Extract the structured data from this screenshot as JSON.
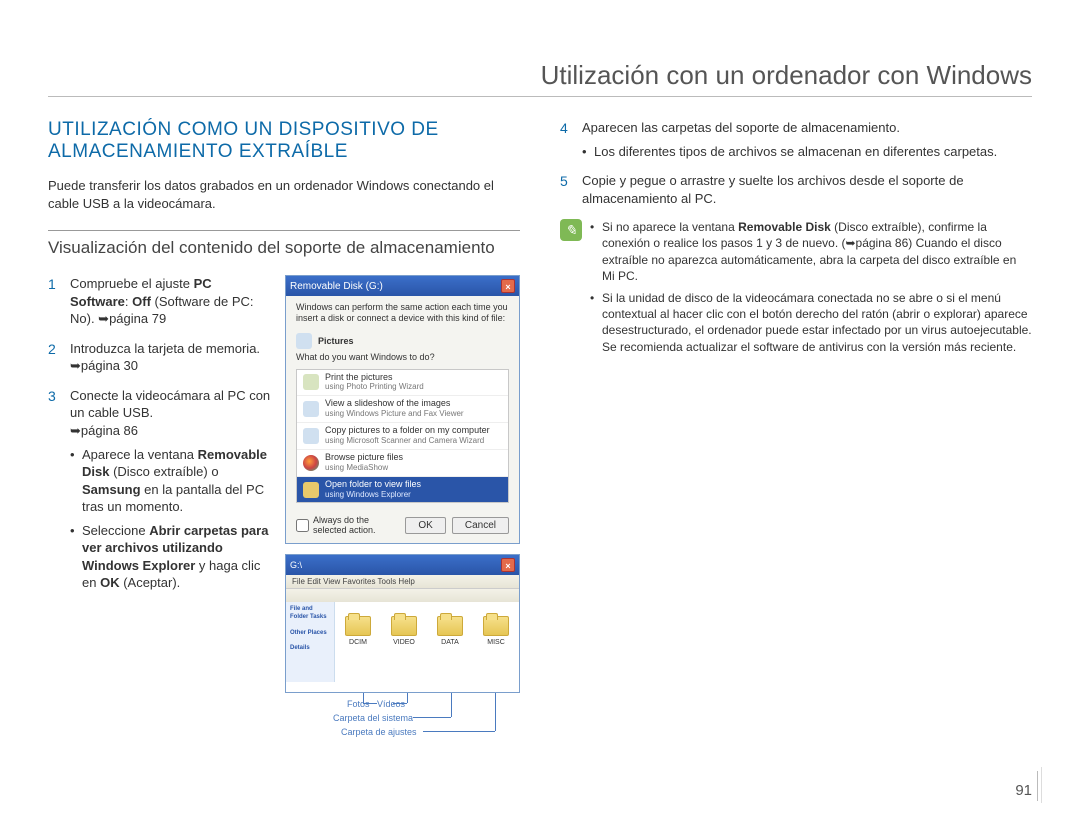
{
  "chapterTitle": "Utilización con un ordenador con Windows",
  "sectionTitle": "UTILIZACIÓN COMO UN DISPOSITIVO DE ALMACENAMIENTO EXTRAÍBLE",
  "intro": "Puede transferir los datos grabados en un ordenador Windows conectando el cable USB a la videocámara.",
  "subsection": "Visualización del contenido del soporte de almacenamiento",
  "steps": {
    "s1a": "Compruebe el ajuste ",
    "s1b": "PC Software",
    "s1c": ": ",
    "s1d": "Off",
    "s1e": " (Software de PC: No). ➥página 79",
    "s2": "Introduzca la tarjeta de memoria. ➥página 30",
    "s3a": "Conecte la videocámara al PC con un cable USB.",
    "s3b": "➥página 86",
    "s3sub1a": "Aparece la ventana ",
    "s3sub1b": "Removable Disk",
    "s3sub1c": " (Disco extraíble) o ",
    "s3sub1d": "Samsung",
    "s3sub1e": " en la pantalla del PC tras un momento.",
    "s3sub2a": "Seleccione ",
    "s3sub2b": "Abrir carpetas para ver archivos utilizando Windows Explorer",
    "s3sub2c": " y haga clic en ",
    "s3sub2d": "OK",
    "s3sub2e": " (Aceptar).",
    "s4": "Aparecen las carpetas del soporte de almacenamiento.",
    "s4sub": "Los diferentes tipos de archivos se almacenan en diferentes carpetas.",
    "s5": "Copie y pegue o arrastre y suelte los archivos desde el soporte de almacenamiento al PC."
  },
  "dialog": {
    "title": "Removable Disk (G:)",
    "text1": "Windows can perform the same action each time you insert a disk or connect a device with this kind of file:",
    "picturesLabel": "Pictures",
    "text2": "What do you want Windows to do?",
    "opt1a": "Print the pictures",
    "opt1b": "using Photo Printing Wizard",
    "opt2a": "View a slideshow of the images",
    "opt2b": "using Windows Picture and Fax Viewer",
    "opt3a": "Copy pictures to a folder on my computer",
    "opt3b": "using Microsoft Scanner and Camera Wizard",
    "opt4a": "Browse picture files",
    "opt4b": "using MediaShow",
    "opt5a": "Open folder to view files",
    "opt5b": "using Windows Explorer",
    "always": "Always do the selected action.",
    "ok": "OK",
    "cancel": "Cancel"
  },
  "explorer": {
    "menu": "File  Edit  View  Favorites  Tools  Help",
    "sideTasks": "File and Folder Tasks",
    "sideOther": "Other Places",
    "sideDetails": "Details",
    "folders": [
      "DCIM",
      "VIDEO",
      "DATA",
      "MISC"
    ],
    "labFotos": "Fotos",
    "labVideos": "Vídeos",
    "labSistema": "Carpeta del sistema",
    "labAjustes": "Carpeta de ajustes"
  },
  "notes": {
    "n1a": "Si no aparece la ventana ",
    "n1b": "Removable Disk",
    "n1c": " (Disco extraíble), confirme la conexión o realice los pasos 1 y 3 de nuevo. (➥página 86) Cuando el disco extraíble no aparezca automáticamente, abra la carpeta del disco extraíble en Mi PC.",
    "n2": "Si la unidad de disco de la videocámara conectada no se abre o si el menú contextual al hacer clic con el botón derecho del ratón (abrir o explorar) aparece desestructurado, el ordenador puede estar infectado por un virus autoejecutable. Se recomienda actualizar el software de antivirus con la versión más reciente."
  },
  "pageNumber": "91"
}
